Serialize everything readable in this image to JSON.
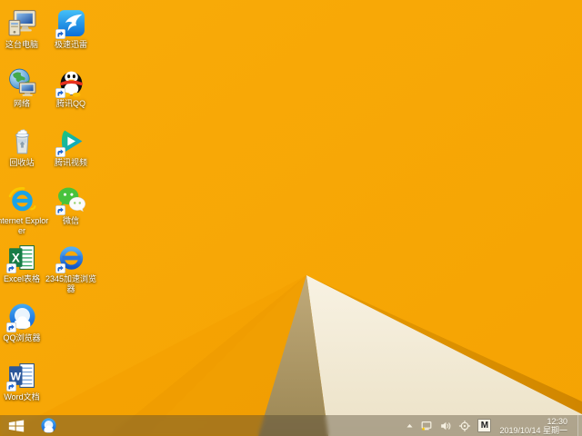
{
  "wallpaper": {
    "base_color": "#f7a606",
    "crease_color": "#d88c00",
    "cream_color": "#f5eedd",
    "tan_color": "#af996a"
  },
  "desktop": {
    "icons": [
      {
        "name": "this-pc",
        "label": "这台电脑",
        "col": 0,
        "row": 0,
        "shortcut": false
      },
      {
        "name": "xunlei-speed",
        "label": "极速迅雷",
        "col": 1,
        "row": 0,
        "shortcut": true
      },
      {
        "name": "network",
        "label": "网络",
        "col": 0,
        "row": 1,
        "shortcut": false
      },
      {
        "name": "tencent-qq",
        "label": "腾讯QQ",
        "col": 1,
        "row": 1,
        "shortcut": true
      },
      {
        "name": "recycle-bin",
        "label": "回收站",
        "col": 0,
        "row": 2,
        "shortcut": false
      },
      {
        "name": "tencent-video",
        "label": "腾讯视频",
        "col": 1,
        "row": 2,
        "shortcut": true
      },
      {
        "name": "internet-explorer",
        "label": "Internet Explorer",
        "col": 0,
        "row": 3,
        "shortcut": false
      },
      {
        "name": "wechat",
        "label": "微信",
        "col": 1,
        "row": 3,
        "shortcut": true
      },
      {
        "name": "excel",
        "label": "Excel表格",
        "col": 0,
        "row": 4,
        "shortcut": true
      },
      {
        "name": "browser-2345",
        "label": "2345加速浏览器",
        "col": 1,
        "row": 4,
        "shortcut": true
      },
      {
        "name": "qq-browser",
        "label": "QQ浏览器",
        "col": 0,
        "row": 5,
        "shortcut": true
      },
      {
        "name": "word",
        "label": "Word文档",
        "col": 0,
        "row": 6,
        "shortcut": true
      }
    ]
  },
  "taskbar": {
    "pinned": [
      {
        "name": "qq-browser"
      }
    ],
    "tray": {
      "icons": [
        "chevron-up",
        "network-status",
        "volume",
        "safety-center",
        "ime-mode"
      ],
      "ime_label": "M",
      "time": "12:30",
      "date": "2019/10/14 星期一"
    }
  }
}
